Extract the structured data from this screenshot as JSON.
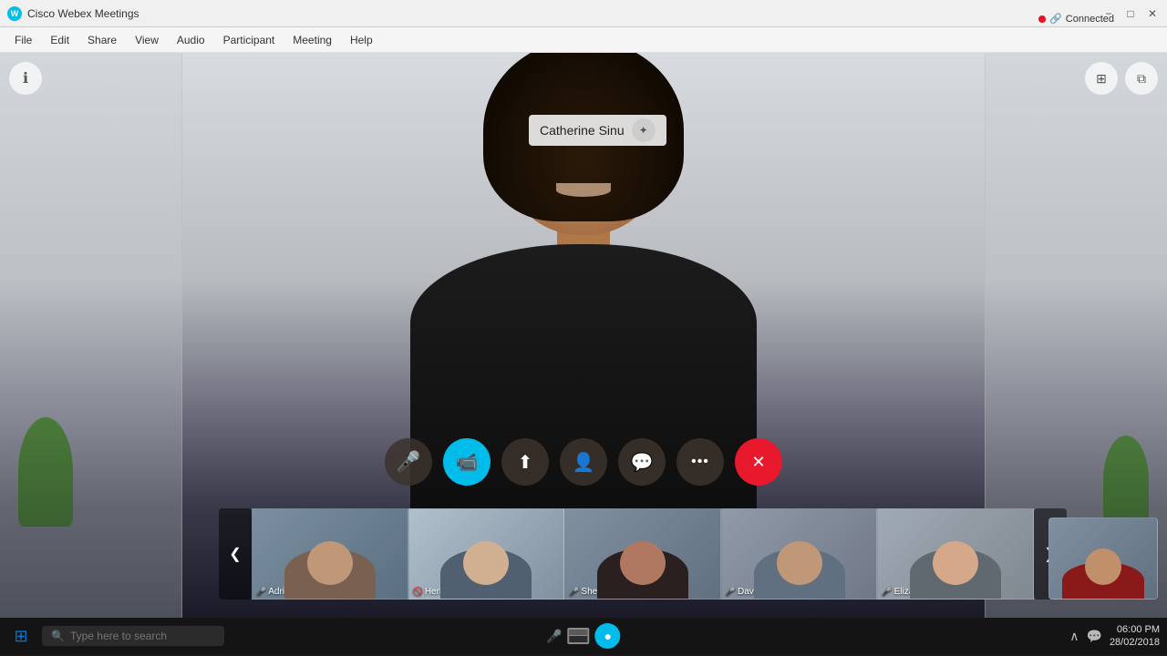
{
  "app": {
    "title": "Cisco Webex Meetings",
    "status": "Connected"
  },
  "title_bar": {
    "app_name": "Cisco Webex Meetings",
    "minimize_label": "−",
    "maximize_label": "□",
    "close_label": "✕"
  },
  "menu": {
    "items": [
      "File",
      "Edit",
      "Share",
      "View",
      "Audio",
      "Participant",
      "Meeting",
      "Help"
    ]
  },
  "main_video": {
    "participant_name": "Catherine Sinu",
    "info_tooltip": "ℹ"
  },
  "controls": [
    {
      "id": "mute",
      "icon": "🎤",
      "label": "Mute",
      "style": "dark",
      "active": false
    },
    {
      "id": "video",
      "icon": "📹",
      "label": "Video",
      "style": "cyan",
      "active": true
    },
    {
      "id": "share",
      "icon": "⬆",
      "label": "Share",
      "style": "dark",
      "active": false
    },
    {
      "id": "participants",
      "icon": "👤",
      "label": "Participants",
      "style": "dark",
      "active": false
    },
    {
      "id": "chat",
      "icon": "💬",
      "label": "Chat",
      "style": "dark",
      "active": false
    },
    {
      "id": "more",
      "icon": "···",
      "label": "More",
      "style": "dark",
      "active": false
    },
    {
      "id": "end",
      "icon": "✕",
      "label": "End",
      "style": "red",
      "active": false
    }
  ],
  "participants": [
    {
      "name": "Adrian Delamico",
      "mic_icon": "🎤",
      "muted": false,
      "tile_class": "tile-0",
      "body_color": "#8a7060",
      "head_color": "#c09070"
    },
    {
      "name": "Herbert Hill",
      "mic_icon": "🎤",
      "muted": true,
      "tile_class": "tile-1",
      "body_color": "#5a6070",
      "head_color": "#d0b090"
    },
    {
      "name": "Sherry McKenna",
      "mic_icon": "🎤",
      "muted": false,
      "tile_class": "tile-2",
      "body_color": "#3a3030",
      "head_color": "#b07860"
    },
    {
      "name": "David Liam",
      "mic_icon": "🎤",
      "muted": false,
      "tile_class": "tile-3",
      "body_color": "#6a7080",
      "head_color": "#c09878"
    },
    {
      "name": "Elizabeth Wu",
      "mic_icon": "🎤",
      "muted": false,
      "tile_class": "tile-4",
      "body_color": "#707880",
      "head_color": "#d4a888"
    }
  ],
  "nav": {
    "prev_label": "❮",
    "next_label": "❯"
  },
  "status": {
    "dot_color": "#e81123",
    "lock_icon": "🔗",
    "connected_label": "Connected"
  },
  "taskbar": {
    "search_placeholder": "Type here to search",
    "time": "06:00 PM",
    "date": "28/02/2018",
    "win_icon": "⊞"
  }
}
